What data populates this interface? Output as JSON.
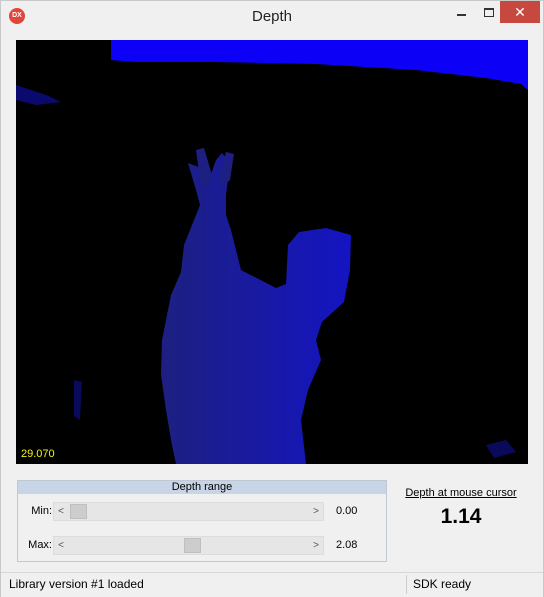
{
  "window": {
    "title": "Depth",
    "app_icon_text": "DX",
    "minimize_icon": "minimize-icon",
    "maximize_icon": "maximize-icon",
    "close_glyph": "✕"
  },
  "depth_view": {
    "fps": "29.070"
  },
  "depth_range": {
    "title": "Depth range",
    "min": {
      "label": "Min:",
      "value": "0.00",
      "position": 0.0
    },
    "max": {
      "label": "Max:",
      "value": "2.08",
      "position": 0.52
    }
  },
  "cursor_depth": {
    "label": "Depth at mouse cursor",
    "value": "1.14"
  },
  "status": {
    "left": "Library version #1 loaded",
    "right": "SDK ready"
  },
  "colors": {
    "depth_far": "#0d00f7",
    "depth_near": "#1a1a8c",
    "fps_text": "#f5f50a",
    "close_button": "#c7483f"
  }
}
